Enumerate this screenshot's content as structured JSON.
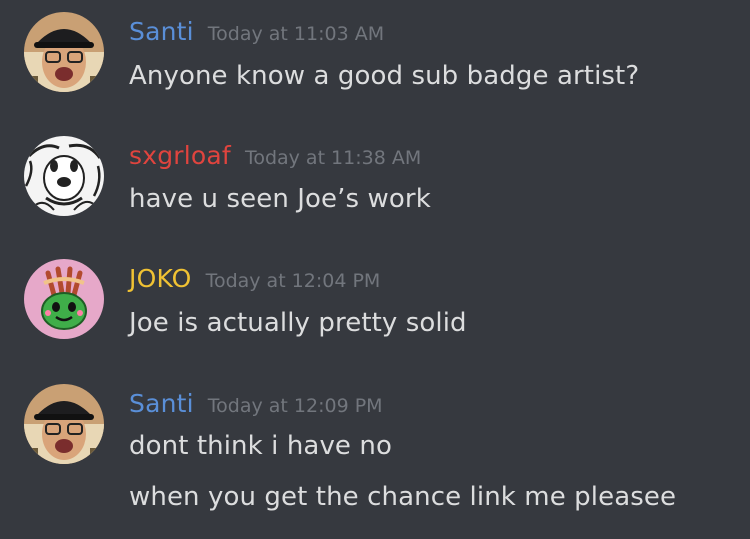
{
  "messages": [
    {
      "username": "Santi",
      "username_color": "#5a8fd8",
      "timestamp": "Today at 11:03 AM",
      "avatar": "person-with-cap-avatar",
      "lines": [
        "Anyone know a good sub badge artist?"
      ]
    },
    {
      "username": "sxgrloaf",
      "username_color": "#e0443e",
      "timestamp": "Today at 11:38 AM",
      "avatar": "cartoon-dog-avatar",
      "lines": [
        "have u seen Joe’s work"
      ]
    },
    {
      "username": "JOKO",
      "username_color": "#f0c233",
      "timestamp": "Today at 12:04 PM",
      "avatar": "green-character-avatar",
      "lines": [
        "Joe is actually pretty solid"
      ]
    },
    {
      "username": "Santi",
      "username_color": "#5a8fd8",
      "timestamp": "Today at 12:09 PM",
      "avatar": "person-with-cap-avatar",
      "lines": [
        "dont think i have no",
        "when you get the chance link me pleasee"
      ]
    }
  ]
}
